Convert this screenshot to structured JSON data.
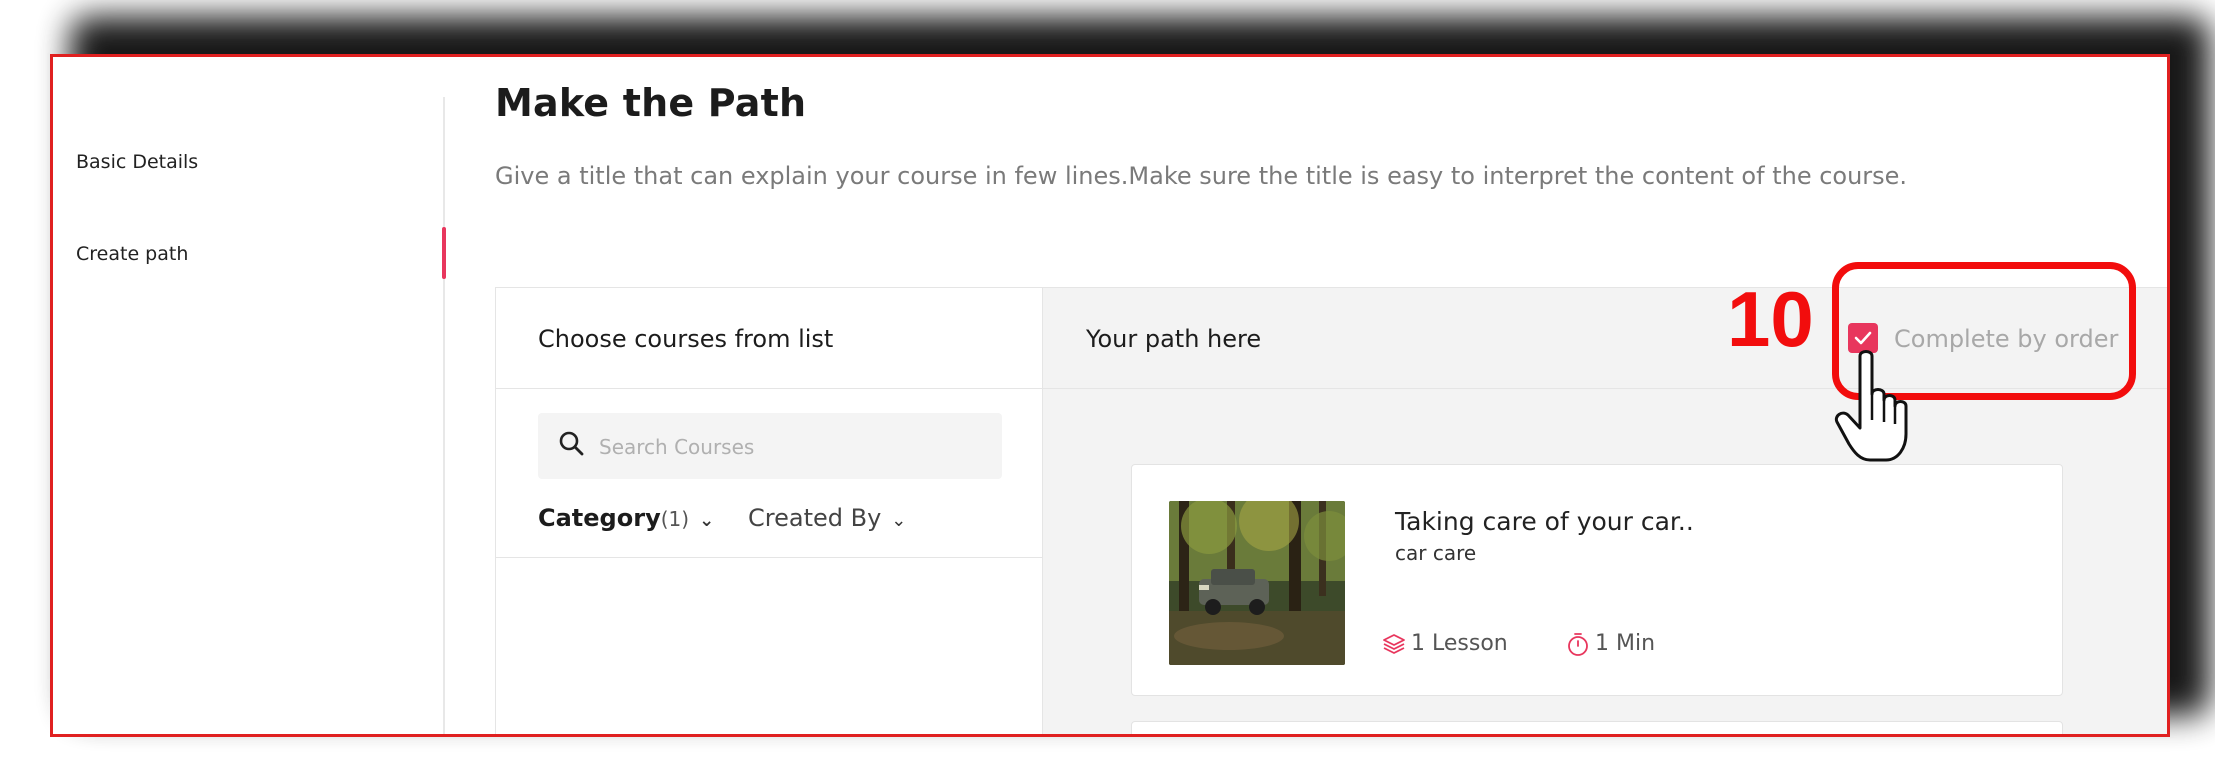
{
  "sidebar": {
    "items": [
      {
        "label": "Basic Details",
        "active": false
      },
      {
        "label": "Create path",
        "active": true
      }
    ]
  },
  "header": {
    "title": "Make the Path",
    "description": "Give a title that can explain your course in few lines.Make sure the title is easy to interpret the content of the course."
  },
  "course_list": {
    "title": "Choose courses from list",
    "search_placeholder": "Search Courses",
    "filters": {
      "category_label": "Category",
      "category_count": "(1)",
      "created_by_label": "Created By"
    }
  },
  "path": {
    "title": "Your path here",
    "complete_by_order_label": "Complete by order",
    "complete_by_order_checked": true,
    "courses": [
      {
        "title": "Taking care of your car..",
        "subtitle": "car care",
        "lessons": "1 Lesson",
        "duration": "1 Min"
      }
    ]
  },
  "annotation": {
    "step_number": "10"
  },
  "colors": {
    "accent": "#e8365d",
    "annotation_red": "#f20d0d"
  }
}
